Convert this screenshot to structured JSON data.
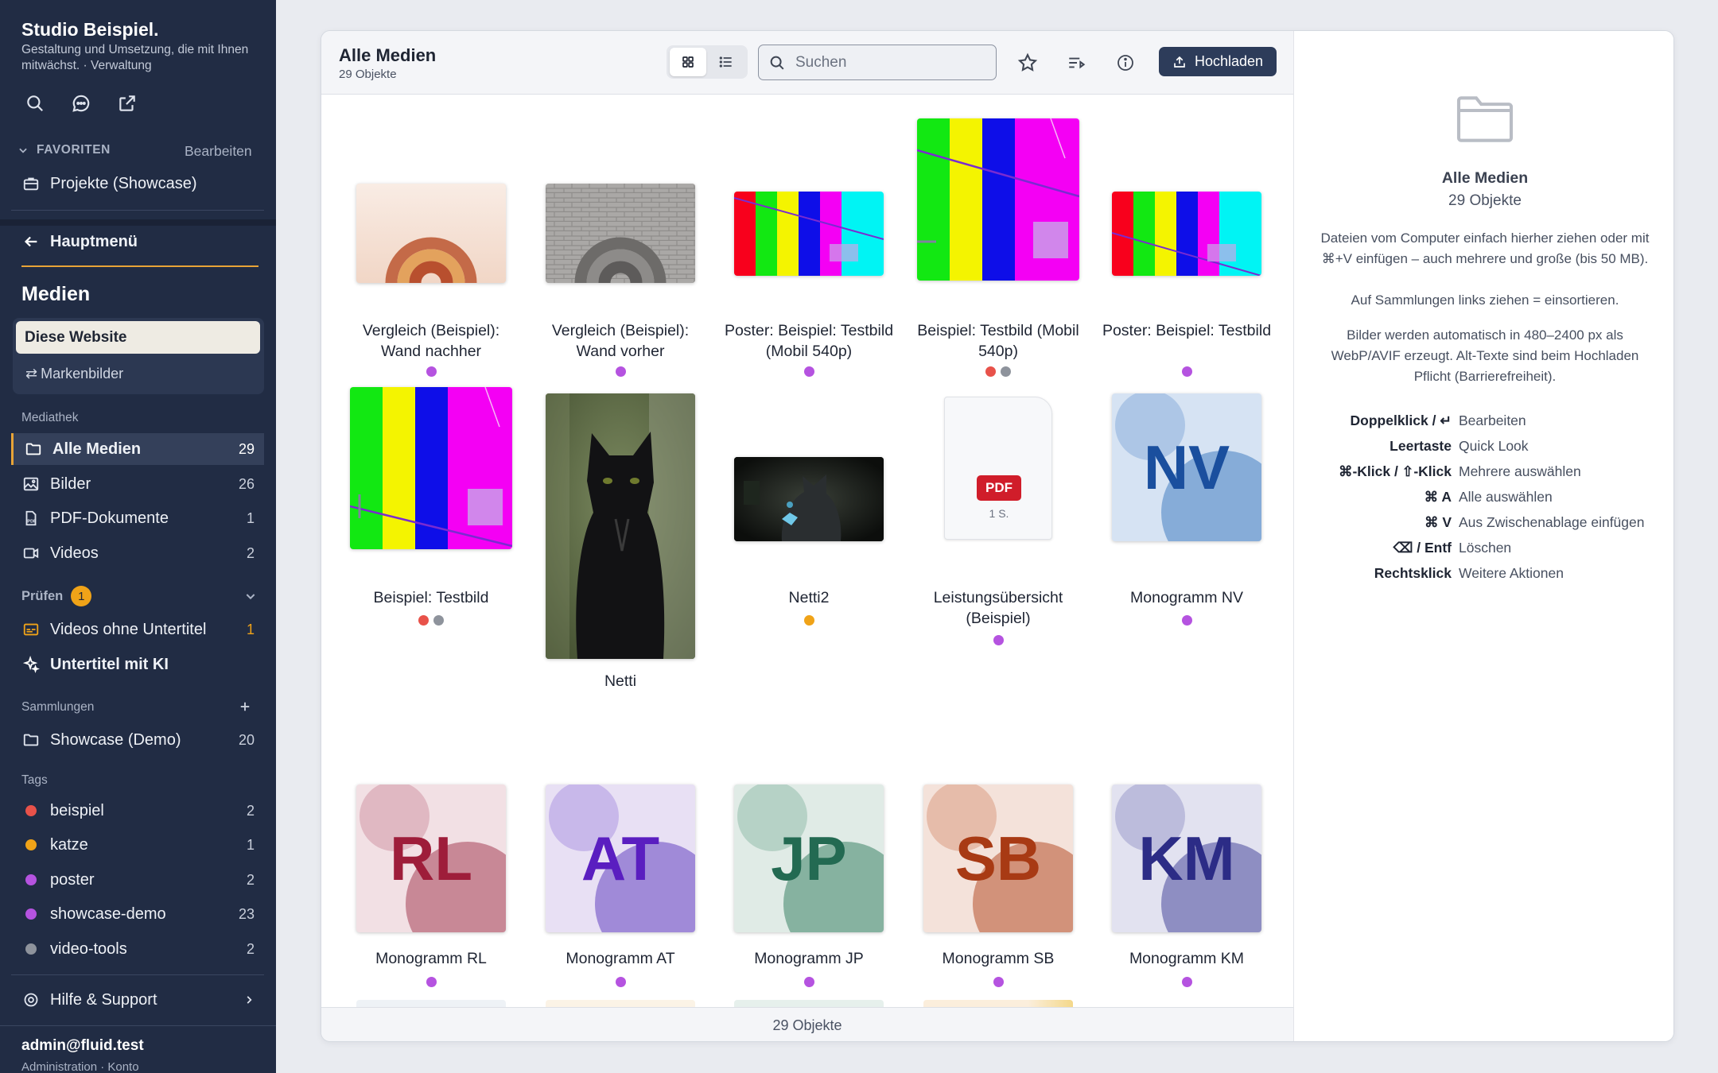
{
  "brand": {
    "name": "Studio Beispiel.",
    "tagline": "Gestaltung und Umsetzung, die mit Ihnen mitwächst. · Verwaltung"
  },
  "sidebar": {
    "favorites_label": "FAVORITEN",
    "favorites_edit": "Bearbeiten",
    "favorites_item": "Projekte (Showcase)",
    "back_label": "Hauptmenü",
    "section_title": "Medien",
    "scope_active": "Diese Website",
    "scope_other": "Markenbilder",
    "library_label": "Mediathek",
    "library": [
      {
        "label": "Alle Medien",
        "count": "29"
      },
      {
        "label": "Bilder",
        "count": "26"
      },
      {
        "label": "PDF-Dokumente",
        "count": "1"
      },
      {
        "label": "Videos",
        "count": "2"
      }
    ],
    "review_label": "Prüfen",
    "review_badge": "1",
    "review_item": {
      "label": "Videos ohne Untertitel",
      "count": "1"
    },
    "ai_item": "Untertitel mit KI",
    "collections_label": "Sammlungen",
    "collection": {
      "label": "Showcase (Demo)",
      "count": "20"
    },
    "tags_label": "Tags",
    "tags": [
      {
        "label": "beispiel",
        "count": "2",
        "color": "#e8524a"
      },
      {
        "label": "katze",
        "count": "1",
        "color": "#f0a318"
      },
      {
        "label": "poster",
        "count": "2",
        "color": "#b553e0"
      },
      {
        "label": "showcase-demo",
        "count": "23",
        "color": "#b553e0"
      },
      {
        "label": "video-tools",
        "count": "2",
        "color": "#8e939c"
      }
    ],
    "help": "Hilfe & Support",
    "user": {
      "email": "admin@fluid.test",
      "sub": "Administration · Konto"
    }
  },
  "header": {
    "title": "Alle Medien",
    "subtitle": "29 Objekte",
    "search_placeholder": "Suchen",
    "upload_label": "Hochladen"
  },
  "items": [
    {
      "caption": "Vergleich (Beispiel): Wand nachher",
      "dots": [
        "#b553e0"
      ]
    },
    {
      "caption": "Vergleich (Beispiel): Wand vorher",
      "dots": [
        "#b553e0"
      ]
    },
    {
      "caption": "Poster: Beispiel: Testbild (Mobil 540p)",
      "dots": [
        "#b553e0"
      ]
    },
    {
      "caption": "Beispiel: Testbild (Mobil 540p)",
      "dots": [
        "#e8524a",
        "#8e939c"
      ]
    },
    {
      "caption": "Poster: Beispiel: Testbild",
      "dots": [
        "#b553e0"
      ]
    },
    {
      "caption": "Beispiel: Testbild",
      "dots": [
        "#e8524a",
        "#8e939c"
      ]
    },
    {
      "caption": "Netti",
      "dots": []
    },
    {
      "caption": "Netti2",
      "dots": [
        "#f0a318"
      ]
    },
    {
      "caption": "Leistungsübersicht (Beispiel)",
      "dots": [
        "#b553e0"
      ],
      "pdf_badge": "PDF",
      "pdf_pages": "1 S."
    },
    {
      "caption": "Monogramm NV",
      "dots": [
        "#b553e0"
      ],
      "initials": "NV"
    },
    {
      "caption": "Monogramm RL",
      "dots": [
        "#b553e0"
      ],
      "initials": "RL"
    },
    {
      "caption": "Monogramm AT",
      "dots": [
        "#b553e0"
      ],
      "initials": "AT"
    },
    {
      "caption": "Monogramm JP",
      "dots": [
        "#b553e0"
      ],
      "initials": "JP"
    },
    {
      "caption": "Monogramm SB",
      "dots": [
        "#b553e0"
      ],
      "initials": "SB"
    },
    {
      "caption": "Monogramm KM",
      "dots": [
        "#b553e0"
      ],
      "initials": "KM"
    }
  ],
  "footer": {
    "count": "29 Objekte"
  },
  "info": {
    "title": "Alle Medien",
    "subtitle": "29 Objekte",
    "p1": "Dateien vom Computer einfach hierher ziehen oder mit ⌘+V einfügen – auch mehrere und große (bis 50 MB).",
    "p2": "Auf Sammlungen links ziehen = einsortieren.",
    "p3": "Bilder werden automatisch in 480–2400 px als WebP/AVIF erzeugt. Alt-Texte sind beim Hochladen Pflicht (Barrierefreiheit).",
    "shortcuts": [
      {
        "key": "Doppelklick / ↵",
        "action": "Bearbeiten"
      },
      {
        "key": "Leertaste",
        "action": "Quick Look"
      },
      {
        "key": "⌘-Klick / ⇧-Klick",
        "action": "Mehrere auswählen"
      },
      {
        "key": "⌘ A",
        "action": "Alle auswählen"
      },
      {
        "key": "⌘ V",
        "action": "Aus Zwischenablage einfügen"
      },
      {
        "key": "⌫ / Entf",
        "action": "Löschen"
      },
      {
        "key": "Rechtsklick",
        "action": "Weitere Aktionen"
      }
    ]
  },
  "colors": {
    "sidebar_bg": "#212c44",
    "accent": "#e8a437",
    "upload_bg": "#2d3c5a",
    "review_badge": "#f0a318"
  }
}
